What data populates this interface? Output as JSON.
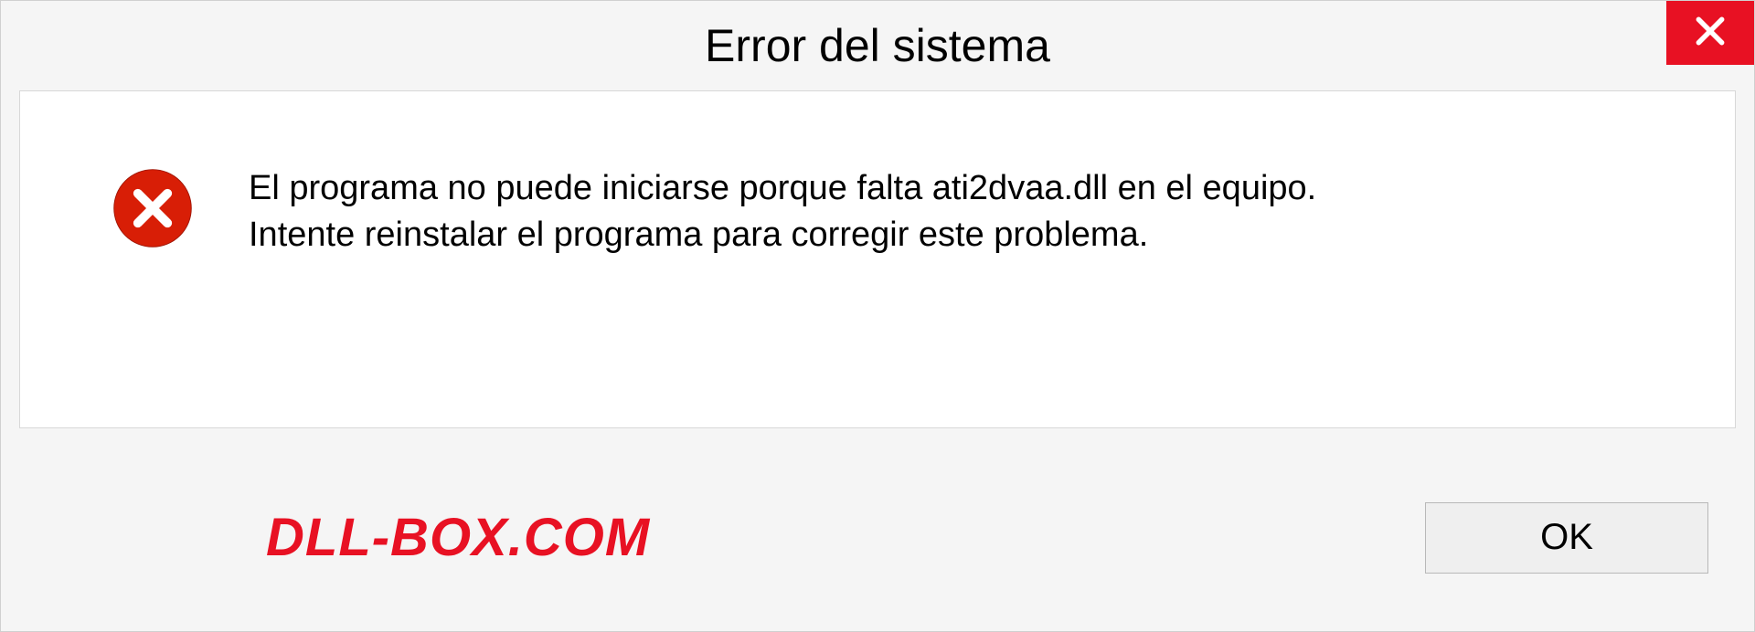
{
  "titlebar": {
    "title": "Error del sistema"
  },
  "message": {
    "line1": "El programa no puede iniciarse porque falta ati2dvaa.dll en el equipo.",
    "line2": "Intente reinstalar el programa para corregir este problema."
  },
  "footer": {
    "watermark": "DLL-BOX.COM",
    "ok_label": "OK"
  },
  "colors": {
    "close_red": "#e81123",
    "error_red": "#d81e06"
  }
}
